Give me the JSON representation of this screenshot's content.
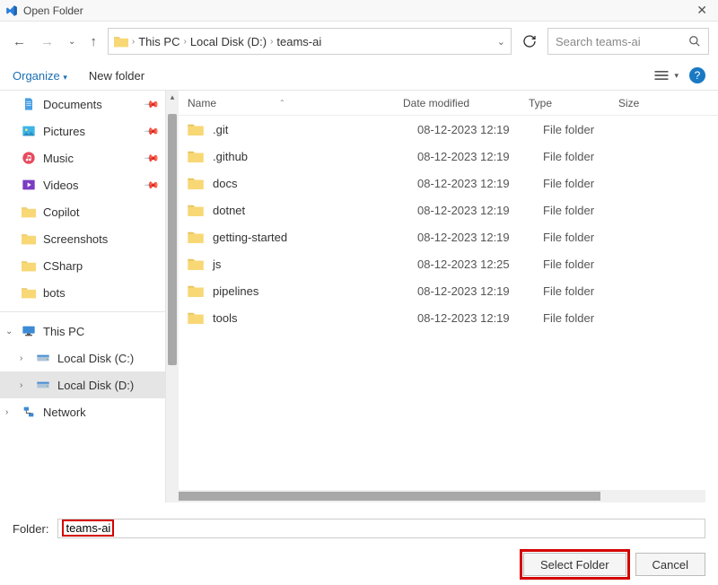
{
  "title": "Open Folder",
  "breadcrumbs": [
    "This PC",
    "Local Disk (D:)",
    "teams-ai"
  ],
  "search": {
    "placeholder": "Search teams-ai"
  },
  "toolbar": {
    "organize": "Organize",
    "new_folder": "New folder"
  },
  "quick_access": [
    {
      "label": "Documents",
      "icon": "documents",
      "pinned": true
    },
    {
      "label": "Pictures",
      "icon": "pictures",
      "pinned": true
    },
    {
      "label": "Music",
      "icon": "music",
      "pinned": true
    },
    {
      "label": "Videos",
      "icon": "videos",
      "pinned": true
    },
    {
      "label": "Copilot",
      "icon": "folder",
      "pinned": false
    },
    {
      "label": "Screenshots",
      "icon": "folder",
      "pinned": false
    },
    {
      "label": "CSharp",
      "icon": "folder",
      "pinned": false
    },
    {
      "label": "bots",
      "icon": "folder",
      "pinned": false
    }
  ],
  "tree": [
    {
      "label": "This PC",
      "icon": "pc",
      "expanded": true,
      "depth": 0
    },
    {
      "label": "Local Disk (C:)",
      "icon": "disk",
      "expanded": false,
      "depth": 1
    },
    {
      "label": "Local Disk (D:)",
      "icon": "disk",
      "expanded": false,
      "depth": 1,
      "selected": true
    },
    {
      "label": "Network",
      "icon": "network",
      "expanded": false,
      "depth": 0
    }
  ],
  "columns": {
    "name": "Name",
    "date": "Date modified",
    "type": "Type",
    "size": "Size"
  },
  "rows": [
    {
      "name": ".git",
      "date": "08-12-2023 12:19",
      "type": "File folder"
    },
    {
      "name": ".github",
      "date": "08-12-2023 12:19",
      "type": "File folder"
    },
    {
      "name": "docs",
      "date": "08-12-2023 12:19",
      "type": "File folder"
    },
    {
      "name": "dotnet",
      "date": "08-12-2023 12:19",
      "type": "File folder"
    },
    {
      "name": "getting-started",
      "date": "08-12-2023 12:19",
      "type": "File folder"
    },
    {
      "name": "js",
      "date": "08-12-2023 12:25",
      "type": "File folder"
    },
    {
      "name": "pipelines",
      "date": "08-12-2023 12:19",
      "type": "File folder"
    },
    {
      "name": "tools",
      "date": "08-12-2023 12:19",
      "type": "File folder"
    }
  ],
  "folder_label": "Folder:",
  "folder_value": "teams-ai",
  "buttons": {
    "select": "Select Folder",
    "cancel": "Cancel"
  }
}
